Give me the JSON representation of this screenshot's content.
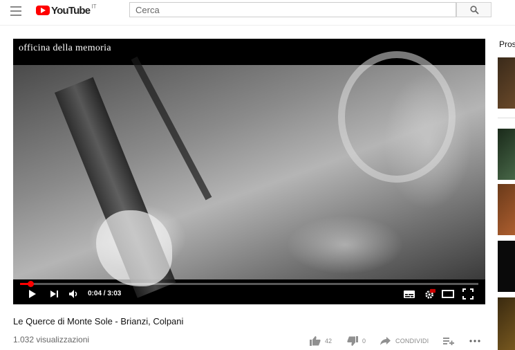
{
  "masthead": {
    "logo_text": "YouTube",
    "country_code": "IT",
    "search_placeholder": "Cerca"
  },
  "player": {
    "watermark": "officina della memoria",
    "time_display": "0:04 / 3:03",
    "progress_fraction": 0.022
  },
  "video": {
    "title": "Le Querce di Monte Sole - Brianzi, Colpani",
    "views": "1.032 visualizzazioni",
    "likes": "42",
    "dislikes": "0",
    "share_label": "CONDIVIDI"
  },
  "sidebar": {
    "up_next_label": "Pros"
  },
  "icons": [
    "menu-icon",
    "youtube-logo-icon",
    "search-icon",
    "play-icon",
    "next-icon",
    "volume-icon",
    "subtitles-icon",
    "settings-hd-icon",
    "theater-mode-icon",
    "fullscreen-icon",
    "like-icon",
    "dislike-icon",
    "share-icon",
    "add-to-playlist-icon",
    "more-icon"
  ],
  "colors": {
    "brand_red": "#ff0000",
    "progress": "#ff0000",
    "hd_badge": "#cc0000"
  }
}
